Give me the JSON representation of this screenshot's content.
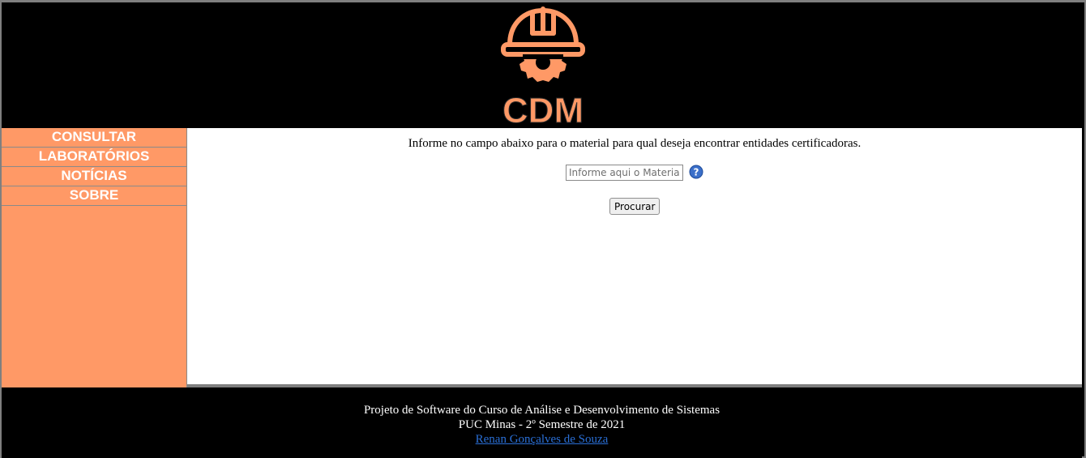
{
  "logo": {
    "text": "CDM",
    "icon": "hardhat-gear-icon",
    "color": "#ff9966"
  },
  "sidebar": {
    "items": [
      {
        "label": "CONSULTAR"
      },
      {
        "label": "LABORATÓRIOS"
      },
      {
        "label": "NOTÍCIAS"
      },
      {
        "label": "SOBRE"
      }
    ]
  },
  "main": {
    "instruction": "Informe no campo abaixo para o material para qual deseja encontrar entidades certificadoras.",
    "search": {
      "placeholder": "Informe aqui o Material",
      "value": ""
    },
    "help_icon": "question-circle-icon",
    "search_button": "Procurar"
  },
  "footer": {
    "line1": "Projeto de Software do Curso de Análise e Desenvolvimento de Sistemas",
    "line2": "PUC Minas - 2º Semestre de 2021",
    "author_link": "Renan Gonçalves de Souza"
  },
  "colors": {
    "accent": "#ff9966",
    "header_bg": "#000000",
    "link": "#2a6fd6"
  }
}
